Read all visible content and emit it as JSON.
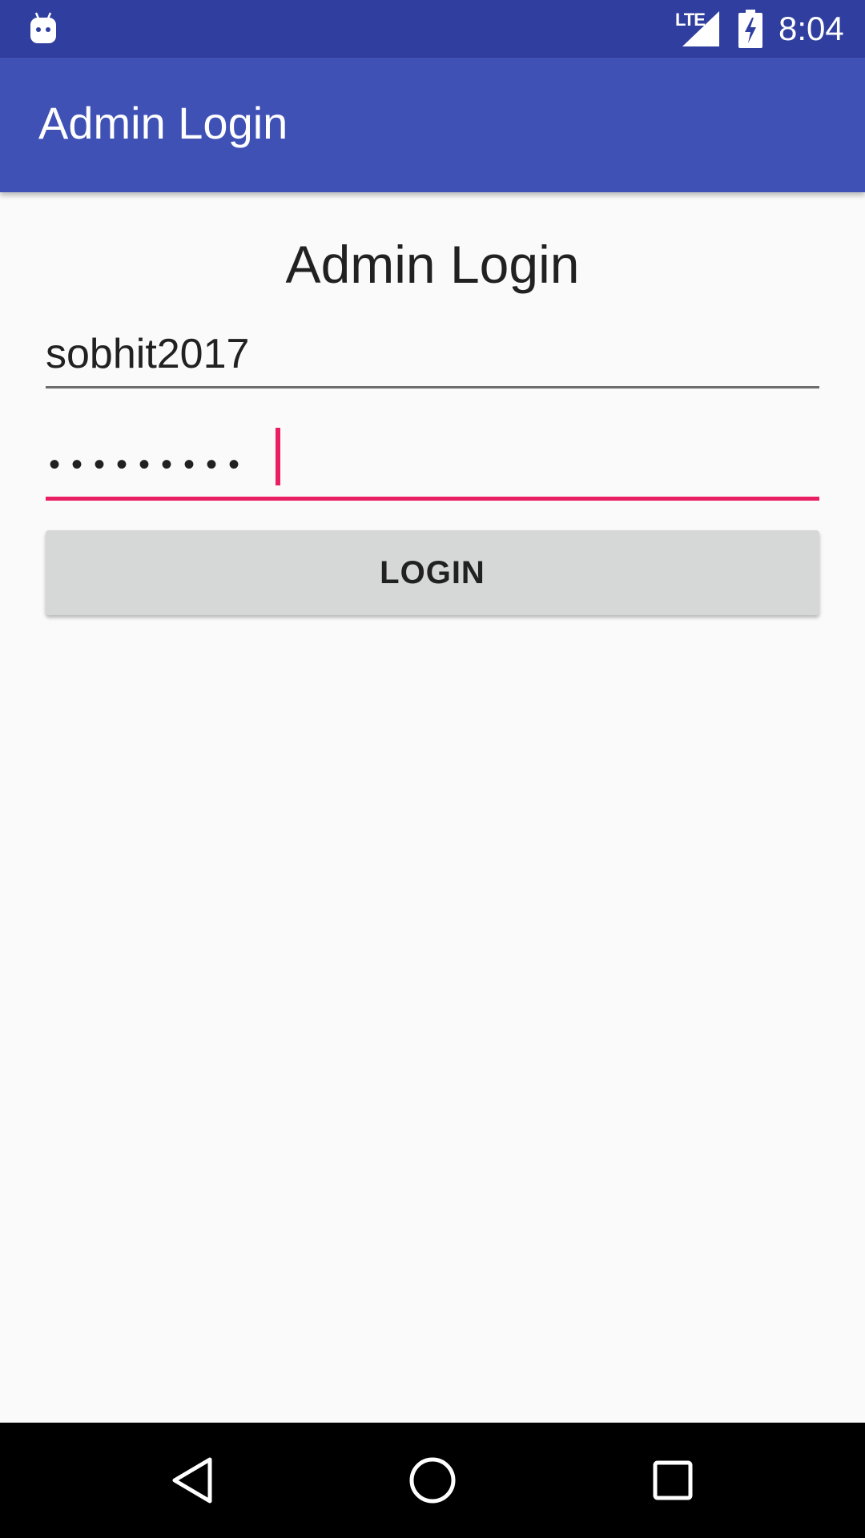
{
  "status_bar": {
    "network_label": "LTE",
    "time": "8:04",
    "icons": [
      "android-notification-icon",
      "signal-icon",
      "battery-charging-icon"
    ]
  },
  "app_bar": {
    "title": "Admin Login"
  },
  "form": {
    "heading": "Admin Login",
    "username_value": "sobhit2017",
    "password_mask": "•••••••••",
    "login_label": "LOGIN"
  },
  "nav_bar": {
    "icons": [
      "back-icon",
      "home-icon",
      "recents-icon"
    ]
  },
  "colors": {
    "status_bar": "#303f9f",
    "app_bar": "#3f51b5",
    "accent": "#e91e63",
    "button": "#d6d7d7",
    "background": "#fafafa"
  }
}
